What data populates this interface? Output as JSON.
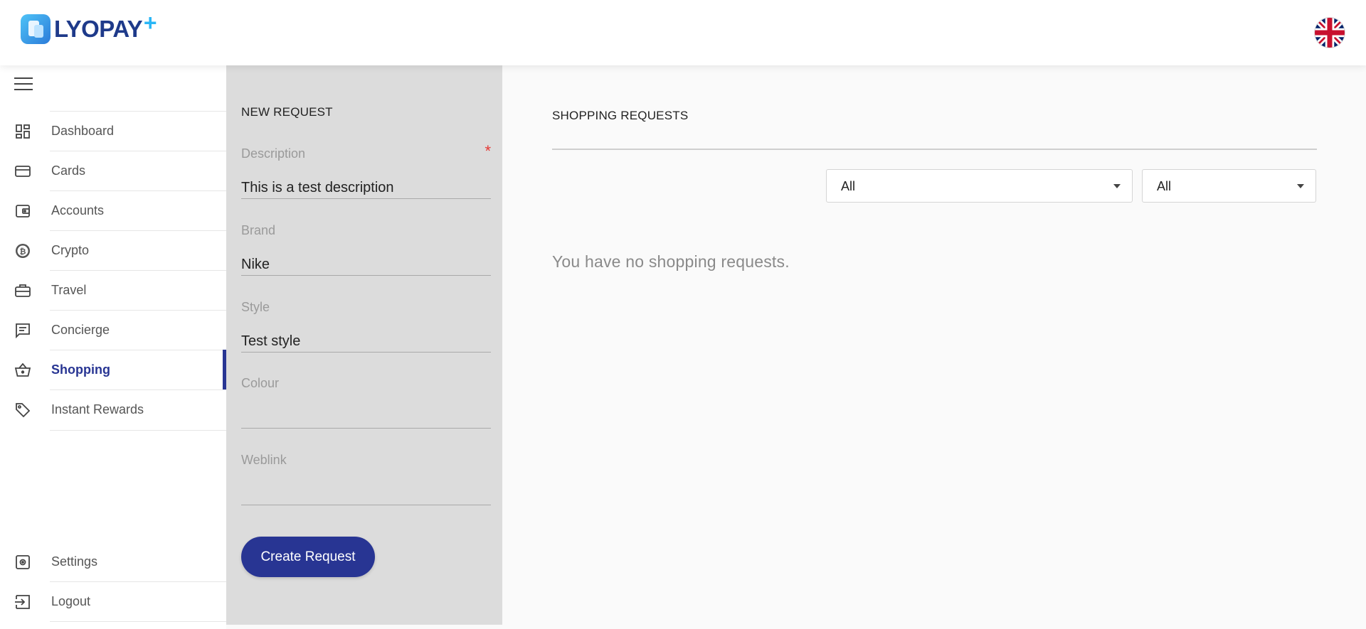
{
  "header": {
    "logo_text": "LYOPAY",
    "logo_plus": "+",
    "language_flag": "uk-flag-icon"
  },
  "sidebar": {
    "items": [
      {
        "label": "Dashboard",
        "icon": "dashboard-icon"
      },
      {
        "label": "Cards",
        "icon": "card-icon"
      },
      {
        "label": "Accounts",
        "icon": "wallet-icon"
      },
      {
        "label": "Crypto",
        "icon": "bitcoin-icon"
      },
      {
        "label": "Travel",
        "icon": "briefcase-icon"
      },
      {
        "label": "Concierge",
        "icon": "chat-icon"
      },
      {
        "label": "Shopping",
        "icon": "basket-icon",
        "active": true
      },
      {
        "label": "Instant Rewards",
        "icon": "tag-icon"
      }
    ],
    "bottom_items": [
      {
        "label": "Settings",
        "icon": "settings-icon"
      },
      {
        "label": "Logout",
        "icon": "logout-icon"
      }
    ]
  },
  "new_request": {
    "title": "NEW REQUEST",
    "fields": [
      {
        "label": "Description",
        "value": "This is a test description",
        "required": "*"
      },
      {
        "label": "Brand",
        "value": "Nike"
      },
      {
        "label": "Style",
        "value": "Test style"
      },
      {
        "label": "Colour",
        "value": ""
      },
      {
        "label": "Weblink",
        "value": ""
      }
    ],
    "submit_label": "Create Request"
  },
  "shopping_requests": {
    "title": "SHOPPING REQUESTS",
    "filter_1": "All",
    "filter_2": "All",
    "empty_message": "You have no shopping requests."
  },
  "colors": {
    "accent": "#283593",
    "panel_bg": "#dcdcdc",
    "required": "#e53935"
  }
}
